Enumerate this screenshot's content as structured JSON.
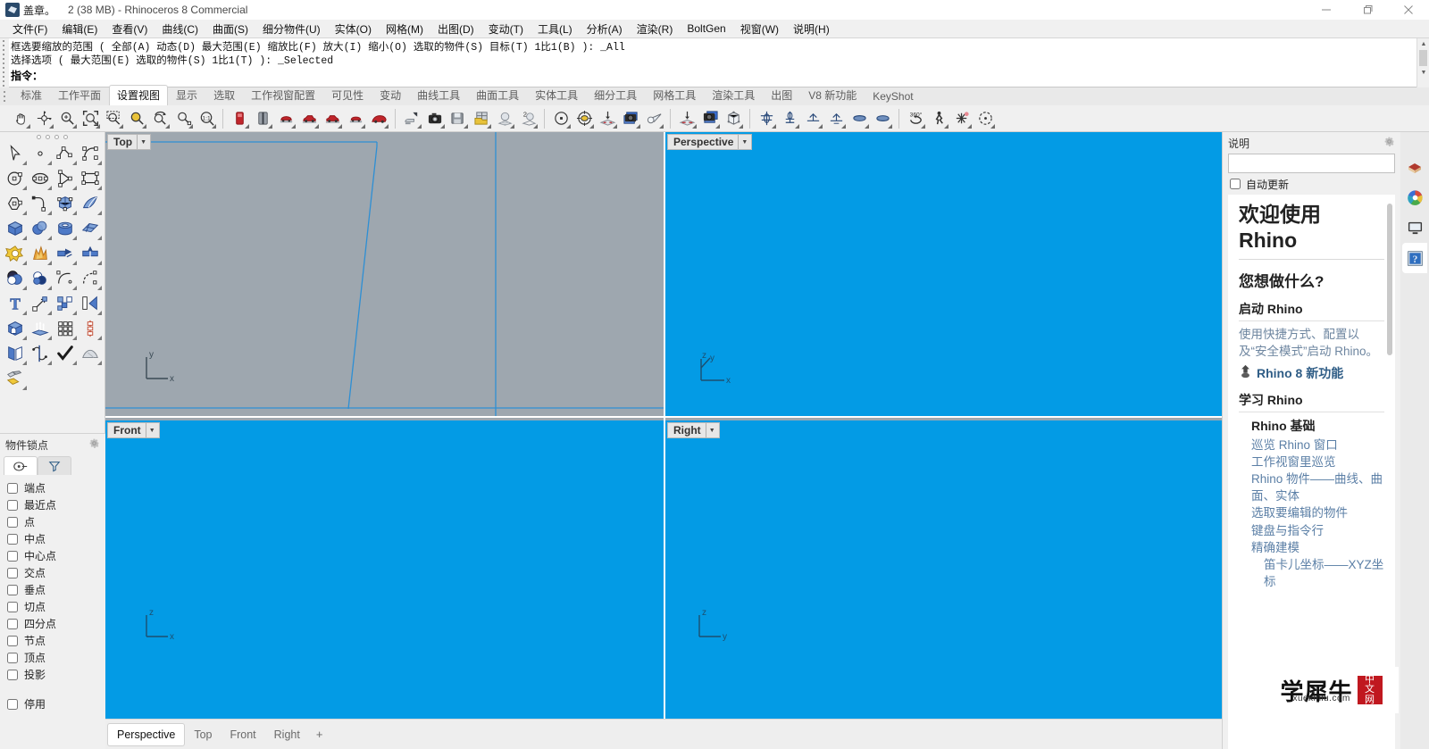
{
  "titlebar": {
    "doc_name": "盖章。",
    "title": "2 (38 MB) - Rhinoceros 8 Commercial",
    "minimize": "minimize-button",
    "maximize": "maximize-button",
    "close": "close-button"
  },
  "menubar": {
    "items": [
      "文件(F)",
      "编辑(E)",
      "查看(V)",
      "曲线(C)",
      "曲面(S)",
      "细分物件(U)",
      "实体(O)",
      "网格(M)",
      "出图(D)",
      "变动(T)",
      "工具(L)",
      "分析(A)",
      "渲染(R)",
      "BoltGen",
      "视窗(W)",
      "说明(H)"
    ]
  },
  "command": {
    "history_line1": "框选要缩放的范围 ( 全部(A)  动态(D)  最大范围(E)  缩放比(F)  放大(I)  缩小(O)  选取的物件(S)  目标(T)  1比1(B) ): _All",
    "history_line2": "选择选项 ( 最大范围(E)  选取的物件(S)  1比1(T) ): _Selected",
    "prompt_label": "指令：",
    "prompt_value": "",
    "prompt_placeholder": ""
  },
  "toolbar_tabs": {
    "active": "设置视图",
    "items": [
      "标准",
      "工作平面",
      "设置视图",
      "显示",
      "选取",
      "工作视窗配置",
      "可见性",
      "变动",
      "曲线工具",
      "曲面工具",
      "实体工具",
      "细分工具",
      "网格工具",
      "渲染工具",
      "出图",
      "V8 新功能",
      "KeyShot"
    ]
  },
  "icon_toolbar": {
    "groups": [
      [
        "pan-icon",
        "rotate-view-icon",
        "zoom-in-out-icon",
        "zoom-extents-icon",
        "zoom-window-icon",
        "zoom-selected-icon",
        "zoom-previous-icon",
        "zoom-target-icon",
        "zoom-one-to-one-icon"
      ],
      [
        "view-front-red-icon",
        "view-side-red-icon",
        "view-car-top-icon",
        "view-car-left-icon",
        "view-car-right-icon",
        "view-car-back-icon",
        "view-car-persp-icon"
      ],
      [
        "named-view-set-icon",
        "named-view-camera-icon",
        "named-view-save-icon",
        "named-view-folder-icon",
        "view-sphere-icon",
        "view-two-sphere-icon"
      ],
      [
        "camera-target-icon",
        "camera-lens-icon",
        "place-camera-icon",
        "camera-snapshot-icon",
        "spotlight-icon"
      ],
      [
        "place-target-icon",
        "snapshot-stack-icon",
        "view-box-icon"
      ],
      [
        "plan-view-icon",
        "elevation-view-icon",
        "top-plane-icon",
        "bottom-plane-icon",
        "perspective-plane-icon",
        "perspective-plane2-icon"
      ],
      [
        "turntable-360-icon",
        "walkthrough-icon",
        "sun-icon",
        "view-rotate-icon"
      ]
    ]
  },
  "left_palette": {
    "rows": [
      [
        "select-arrow-icon",
        "point-icon",
        "polyline-icon",
        "curve-icon"
      ],
      [
        "circle-icon",
        "ellipse-icon",
        "arc-icon",
        "rectangle-icon"
      ],
      [
        "polygon-icon",
        "fillet-curve-icon",
        "surface-from-curves-icon",
        "loft-surface-icon"
      ],
      [
        "box-icon",
        "sphere-icon",
        "cylinder-icon",
        "surface-patch-icon"
      ],
      [
        "boolean-union-icon",
        "explode-icon",
        "trim-icon",
        "split-icon"
      ],
      [
        "boolean-difference-icon",
        "boolean-intersection-icon",
        "offset-curve-icon",
        "curve-from-object-icon"
      ],
      [
        "text-icon",
        "scale-icon",
        "array-icon",
        "extrude-icon"
      ],
      [
        "solid-tools-icon",
        "extrude-up-icon",
        "grid-array-icon",
        "polar-array-icon"
      ],
      [
        "mirror-icon",
        "rotate-icon",
        "check-mark-icon",
        "mesh-tools-icon"
      ],
      [
        "paint-gradient-icon"
      ]
    ]
  },
  "object_snap": {
    "title": "物件锁点",
    "tabs": [
      "osnap-tab-icon",
      "filter-tab-icon"
    ],
    "items": [
      {
        "label": "端点",
        "checked": false
      },
      {
        "label": "最近点",
        "checked": false
      },
      {
        "label": "点",
        "checked": false
      },
      {
        "label": "中点",
        "checked": false
      },
      {
        "label": "中心点",
        "checked": false
      },
      {
        "label": "交点",
        "checked": false
      },
      {
        "label": "垂点",
        "checked": false
      },
      {
        "label": "切点",
        "checked": false
      },
      {
        "label": "四分点",
        "checked": false
      },
      {
        "label": "节点",
        "checked": false
      },
      {
        "label": "顶点",
        "checked": false
      },
      {
        "label": "投影",
        "checked": false
      }
    ],
    "disable": {
      "label": "停用",
      "checked": false
    }
  },
  "viewports": {
    "top": {
      "label": "Top",
      "axis_x": "x",
      "axis_y": "y",
      "bg": "#9ea7af"
    },
    "persp": {
      "label": "Perspective",
      "axis_x": "x",
      "axis_y": "y",
      "axis_z": "z",
      "bg": "#039be5"
    },
    "front": {
      "label": "Front",
      "axis_x": "x",
      "axis_y": "z",
      "bg": "#039be5"
    },
    "right": {
      "label": "Right",
      "axis_x": "y",
      "axis_y": "z",
      "bg": "#039be5"
    },
    "curve_color": "#2e8fd4",
    "tabs": {
      "active": "Perspective",
      "items": [
        "Perspective",
        "Top",
        "Front",
        "Right"
      ],
      "add": "+"
    }
  },
  "help_panel": {
    "title": "说明",
    "search_value": "",
    "search_placeholder": "",
    "auto_update": {
      "label": "自动更新",
      "checked": false
    },
    "heading_line1": "欢迎使用",
    "heading_line2": "Rhino",
    "subheading": "您想做什么?",
    "section_start": {
      "title": "启动 Rhino",
      "paragraph": "使用快捷方式、配置以及“安全模式”启动 Rhino。",
      "new_features_link": "Rhino 8 新功能"
    },
    "section_learn": {
      "title": "学习 Rhino",
      "sub_title": "Rhino 基础",
      "links": [
        "巡览 Rhino 窗口",
        "工作视窗里巡览",
        "Rhino 物件——曲线、曲面、实体",
        "选取要编辑的物件",
        "键盘与指令行",
        "精确建模"
      ],
      "sub_links": [
        "笛卡儿坐标——XYZ坐标"
      ]
    }
  },
  "right_rail": {
    "items": [
      "layers-icon",
      "color-wheel-icon",
      "display-icon",
      "help-icon"
    ],
    "active": "help-icon"
  },
  "watermark": {
    "text": "学犀牛",
    "url": "xuexiniu.com",
    "badge_line1": "中",
    "badge_line2": "文",
    "badge_line3": "网"
  }
}
